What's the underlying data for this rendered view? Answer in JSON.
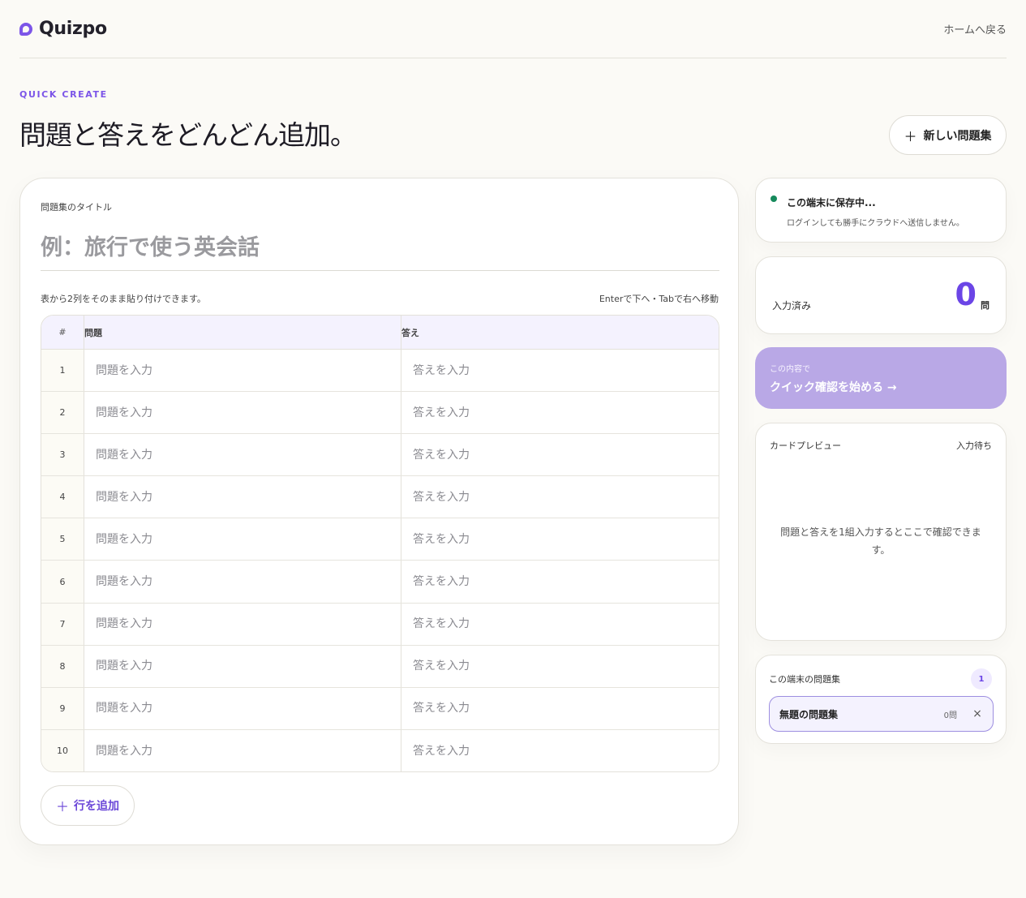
{
  "brand": {
    "name": "Quizpo"
  },
  "nav": {
    "home_link": "ホームへ戻る"
  },
  "hero": {
    "eyebrow": "QUICK CREATE",
    "title": "問題と答えをどんどん追加。",
    "new_set_button": "新しい問題集"
  },
  "editor": {
    "title_label": "問題集のタイトル",
    "title_placeholder": "例：旅行で使う英会話",
    "title_value": "",
    "hint_left": "表から2列をそのまま貼り付けできます。",
    "hint_right": "Enterで下へ・Tabで右へ移動",
    "columns": {
      "num": "#",
      "question": "問題",
      "answer": "答え"
    },
    "question_placeholder": "問題を入力",
    "answer_placeholder": "答えを入力",
    "rows": [
      {
        "num": "1",
        "question": "",
        "answer": ""
      },
      {
        "num": "2",
        "question": "",
        "answer": ""
      },
      {
        "num": "3",
        "question": "",
        "answer": ""
      },
      {
        "num": "4",
        "question": "",
        "answer": ""
      },
      {
        "num": "5",
        "question": "",
        "answer": ""
      },
      {
        "num": "6",
        "question": "",
        "answer": ""
      },
      {
        "num": "7",
        "question": "",
        "answer": ""
      },
      {
        "num": "8",
        "question": "",
        "answer": ""
      },
      {
        "num": "9",
        "question": "",
        "answer": ""
      },
      {
        "num": "10",
        "question": "",
        "answer": ""
      }
    ],
    "add_row_button": "行を追加"
  },
  "sidebar": {
    "status": {
      "title": "この端末に保存中...",
      "subtitle": "ログインしても勝手にクラウドへ送信しません。"
    },
    "count": {
      "label": "入力済み",
      "value": "0",
      "unit": "問"
    },
    "start": {
      "subtitle": "この内容で",
      "title": "クイック確認を始める →"
    },
    "preview": {
      "label": "カードプレビュー",
      "status": "入力待ち",
      "message": "問題と答えを1組入力するとここで確認できます。"
    },
    "sets": {
      "label": "この端末の問題集",
      "badge": "1",
      "items": [
        {
          "name": "無題の問題集",
          "count": "0問"
        }
      ]
    }
  },
  "colors": {
    "accent": "#6b45e6",
    "background": "#fbfaf6",
    "start_button": "#b9a8e6",
    "status_dot": "#168a5c"
  }
}
